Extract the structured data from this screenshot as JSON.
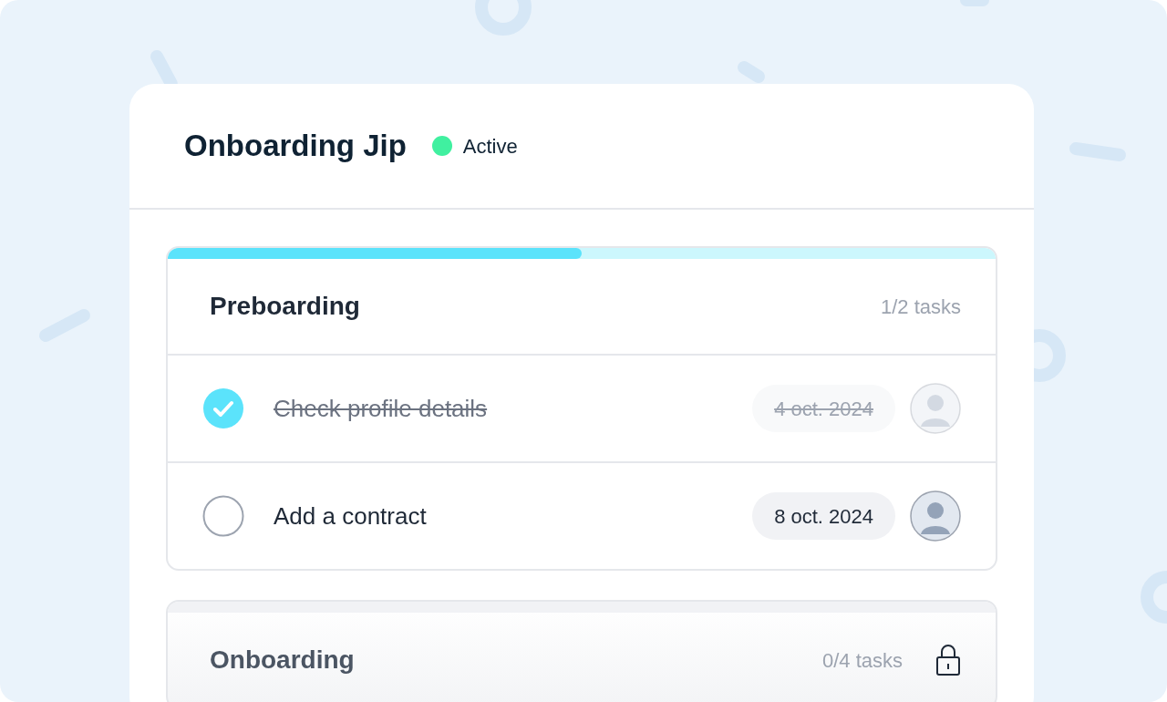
{
  "title": "Onboarding Jip",
  "status": {
    "label": "Active",
    "active": true,
    "color": "#40f0a0"
  },
  "stages": [
    {
      "title": "Preboarding",
      "count": "1/2 tasks",
      "level": 0.5,
      "locked": false,
      "tasks": [
        {
          "label": "Check profile details",
          "done": true,
          "date": "4 oct. 2024"
        },
        {
          "label": "Add a contract",
          "done": false,
          "date": "8 oct. 2024"
        }
      ]
    },
    {
      "title": "Onboarding",
      "count": "0/4 tasks",
      "level": 0,
      "locked": true
    }
  ]
}
